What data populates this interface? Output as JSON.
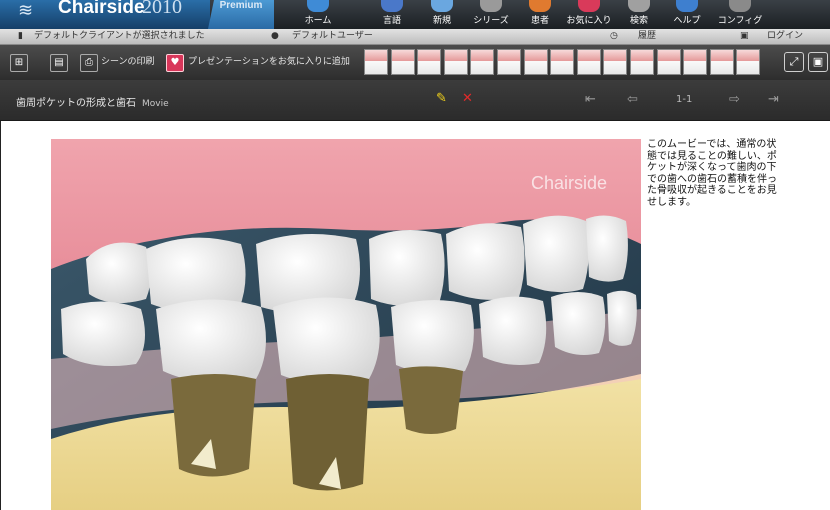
{
  "app": {
    "brand": "Chairside",
    "year": "2010",
    "edition": "Premium"
  },
  "menu": [
    {
      "label": "ホーム",
      "icon": "home-icon",
      "color": "#3f8bd6"
    },
    {
      "label": "言語",
      "icon": "language-icon",
      "color": "#4a78c9"
    },
    {
      "label": "新規",
      "icon": "new-icon",
      "color": "#6aa7e0"
    },
    {
      "label": "シリーズ",
      "icon": "series-icon",
      "color": "#9a9a9a"
    },
    {
      "label": "患者",
      "icon": "patient-icon",
      "color": "#e07a2f"
    },
    {
      "label": "お気に入り",
      "icon": "favorites-icon",
      "color": "#d93a5a"
    },
    {
      "label": "検索",
      "icon": "search-icon",
      "color": "#a0a0a0"
    },
    {
      "label": "ヘルプ",
      "icon": "help-icon",
      "color": "#3e7fcf"
    },
    {
      "label": "コンフィグ",
      "icon": "config-icon",
      "color": "#8a8a8a"
    }
  ],
  "status": {
    "client": "デフォルトクライアントが選択されました",
    "user": "デフォルトユーザー",
    "history": "履歴",
    "login": "ログイン"
  },
  "toolbar": {
    "print_label": "シーンの印刷",
    "favorite_label": "プレゼンテーションをお気に入りに追加",
    "thumbnails": 15
  },
  "scene": {
    "title": "歯周ポケットの形成と歯石",
    "type": "Movie",
    "page": "1-1",
    "watermark": "Chairside",
    "description": "このムービーでは、通常の状態では見ることの難しい、ポケットが深くなって歯肉の下での歯への歯石の蓄積を伴った骨吸収が起きることをお見せします。"
  },
  "colors": {
    "topbar": "#23272b",
    "accent_blue": "#1e4f84",
    "gum": "#e8a0a8",
    "bone": "#f0dc9c",
    "tartar": "#7a6a3c"
  }
}
